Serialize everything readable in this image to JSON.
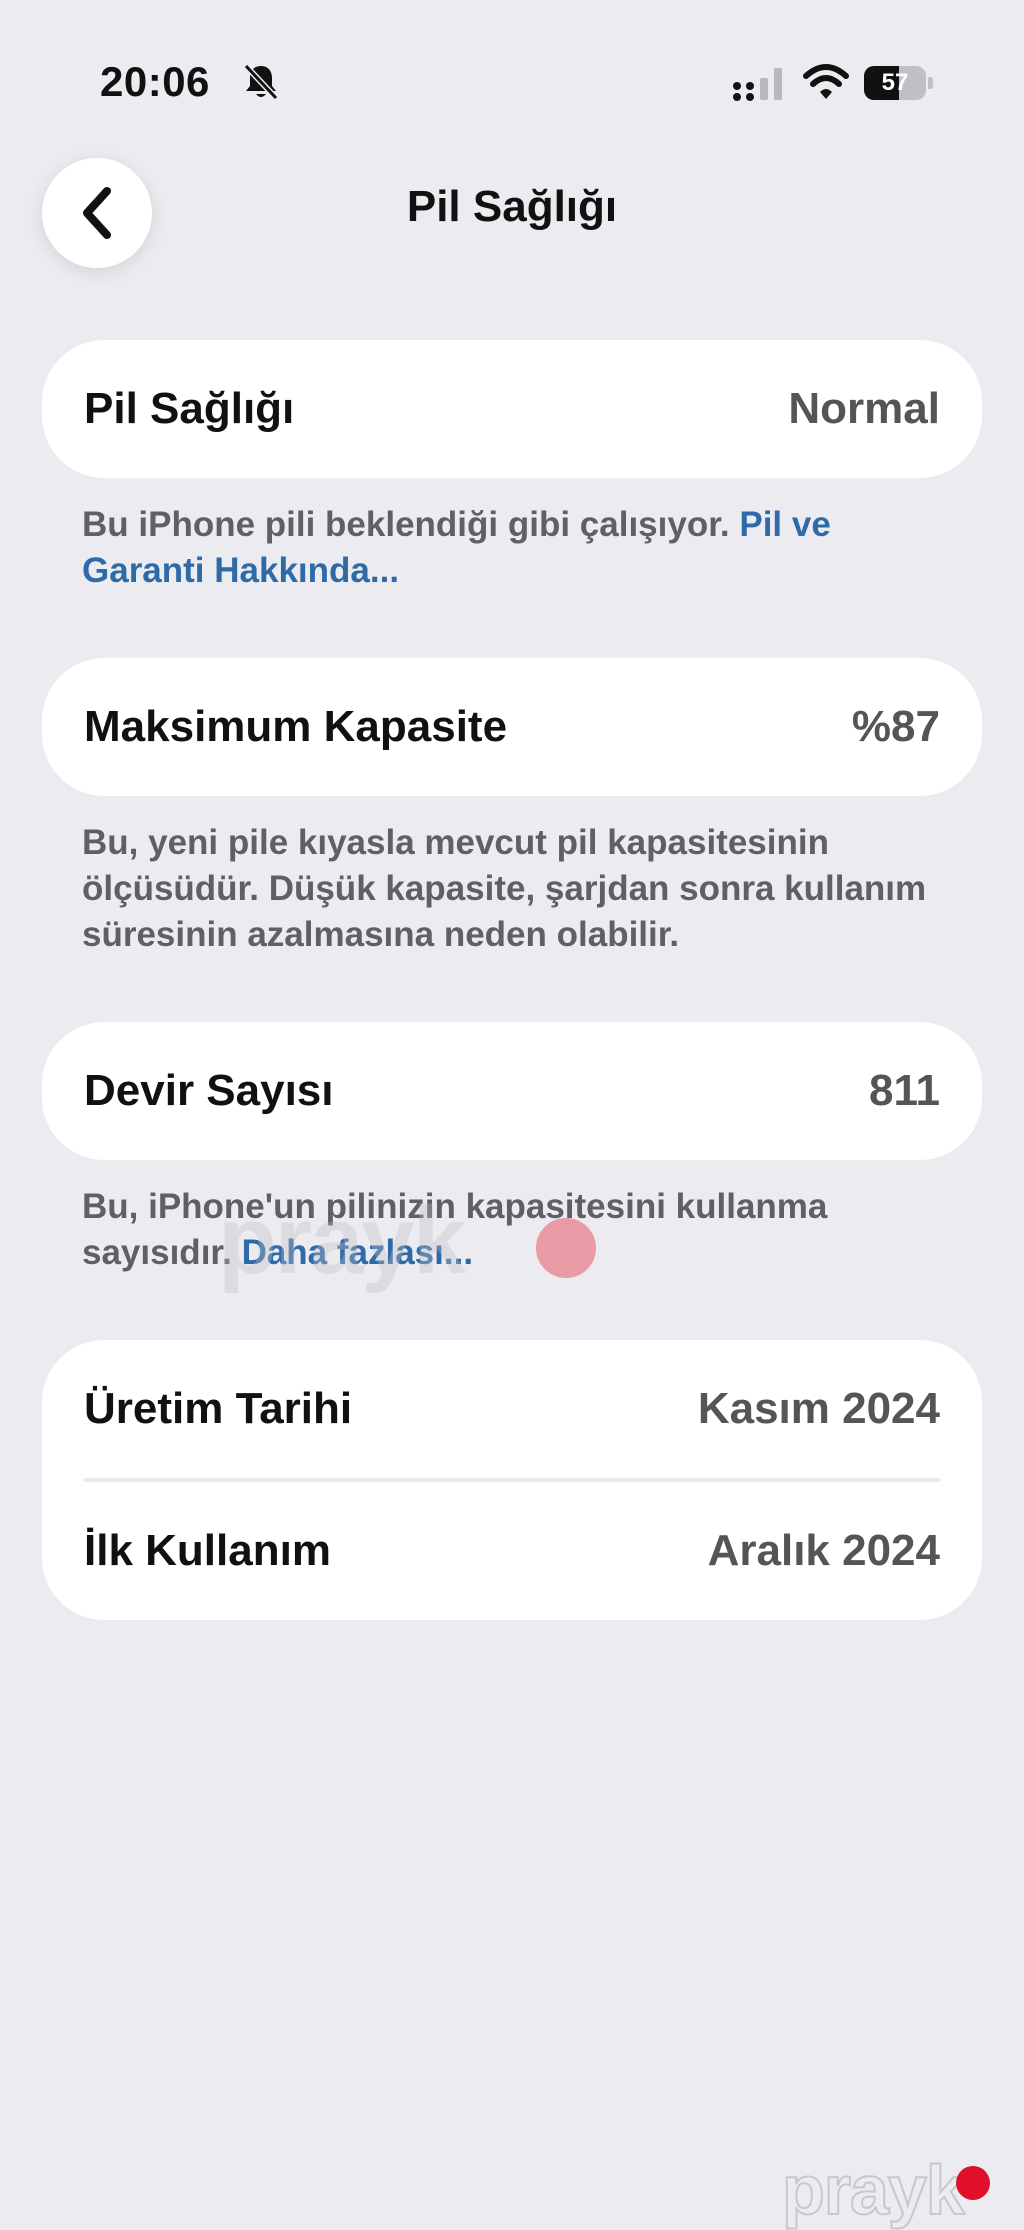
{
  "status_bar": {
    "time": "20:06",
    "battery_level": "57",
    "battery_fraction": 0.57
  },
  "nav": {
    "title": "Pil Sağlığı",
    "back_icon": "chevron-left-icon"
  },
  "battery_health": {
    "label": "Pil Sağlığı",
    "value": "Normal",
    "note_text": "Bu iPhone pili beklendiği gibi çalışıyor. ",
    "note_link": "Pil ve Garanti Hakkında..."
  },
  "max_capacity": {
    "label": "Maksimum Kapasite",
    "value": "%87",
    "note_text": "Bu, yeni pile kıyasla mevcut pil kapasitesinin ölçüsüdür. Düşük kapasite, şarjdan sonra kullanım süresinin azalmasına neden olabilir."
  },
  "cycle_count": {
    "label": "Devir Sayısı",
    "value": "811",
    "note_text": "Bu, iPhone'un pilinizin kapasitesini kullanma sayısıdır. ",
    "note_link": "Daha fazlası..."
  },
  "dates": {
    "manufacture_label": "Üretim Tarihi",
    "manufacture_value": "Kasım 2024",
    "first_use_label": "İlk Kullanım",
    "first_use_value": "Aralık 2024"
  },
  "watermark": {
    "text": "prayk"
  },
  "colors": {
    "background": "#ebebf0",
    "card": "#ffffff",
    "link": "#2f6aa8",
    "secondary_text": "#5f5f66",
    "brand_dot": "#e0102a"
  }
}
